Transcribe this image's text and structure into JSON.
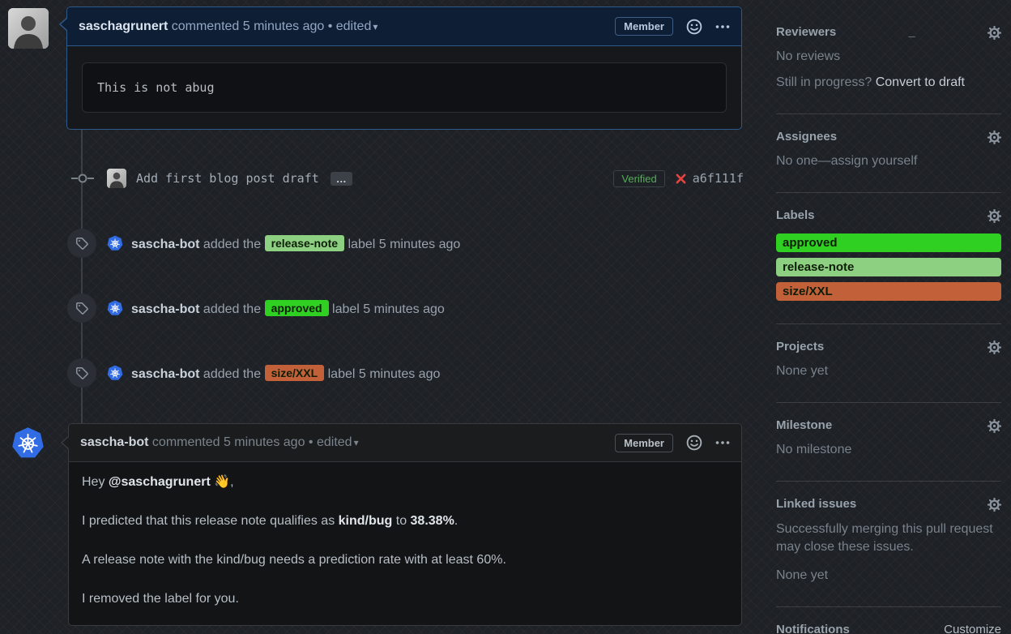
{
  "colors": {
    "accent_border": "#2e5a8a",
    "approved_label": "#2fd021",
    "release_note_label": "#8ed081",
    "size_xxl_label": "#c2603a",
    "verified_green": "#57ab5a",
    "failed_red": "#e8443f",
    "k8s_blue": "#326ce5"
  },
  "comment_highlighted": {
    "author": "saschagrunert",
    "meta": "commented 5 minutes ago • edited",
    "member_badge": "Member",
    "code_body": "This is not abug"
  },
  "commit_event": {
    "message": "Add first blog post draft",
    "expander": "…",
    "verified_badge": "Verified",
    "hash": "a6f111f"
  },
  "label_events": [
    {
      "actor": "sascha-bot",
      "action": "added the",
      "label": "release-note",
      "label_color": "#8ed081",
      "suffix": "label 5 minutes ago"
    },
    {
      "actor": "sascha-bot",
      "action": "added the",
      "label": "approved",
      "label_color": "#2fd021",
      "suffix": "label 5 minutes ago"
    },
    {
      "actor": "sascha-bot",
      "action": "added the",
      "label": "size/XXL",
      "label_color": "#c2603a",
      "suffix": "label 5 minutes ago"
    }
  ],
  "comment_bot": {
    "author": "sascha-bot",
    "meta": "commented 5 minutes ago • edited",
    "member_badge": "Member",
    "p1_pre": "Hey ",
    "p1_mention": "@saschagrunert",
    "p1_post": " 👋,",
    "p2_pre": "I predicted that this release note qualifies as ",
    "p2_bold1": "kind/bug",
    "p2_mid": " to ",
    "p2_bold2": "38.38%",
    "p2_post": ".",
    "p3": "A release note with the kind/bug needs a prediction rate with at least 60%.",
    "p4": "I removed the label for you."
  },
  "sidebar": {
    "reviewers": {
      "title": "Reviewers",
      "empty": "No reviews",
      "hint_pre": "Still in progress? ",
      "hint_link": "Convert to draft"
    },
    "assignees": {
      "title": "Assignees",
      "empty": "No one—assign yourself"
    },
    "labels": {
      "title": "Labels",
      "items": [
        {
          "name": "approved",
          "color": "#2fd021"
        },
        {
          "name": "release-note",
          "color": "#8ed081"
        },
        {
          "name": "size/XXL",
          "color": "#c2603a"
        }
      ]
    },
    "projects": {
      "title": "Projects",
      "empty": "None yet"
    },
    "milestone": {
      "title": "Milestone",
      "empty": "No milestone"
    },
    "linked_issues": {
      "title": "Linked issues",
      "desc": "Successfully merging this pull request may close these issues.",
      "empty": "None yet"
    },
    "notifications": {
      "title": "Notifications",
      "action": "Customize"
    }
  }
}
